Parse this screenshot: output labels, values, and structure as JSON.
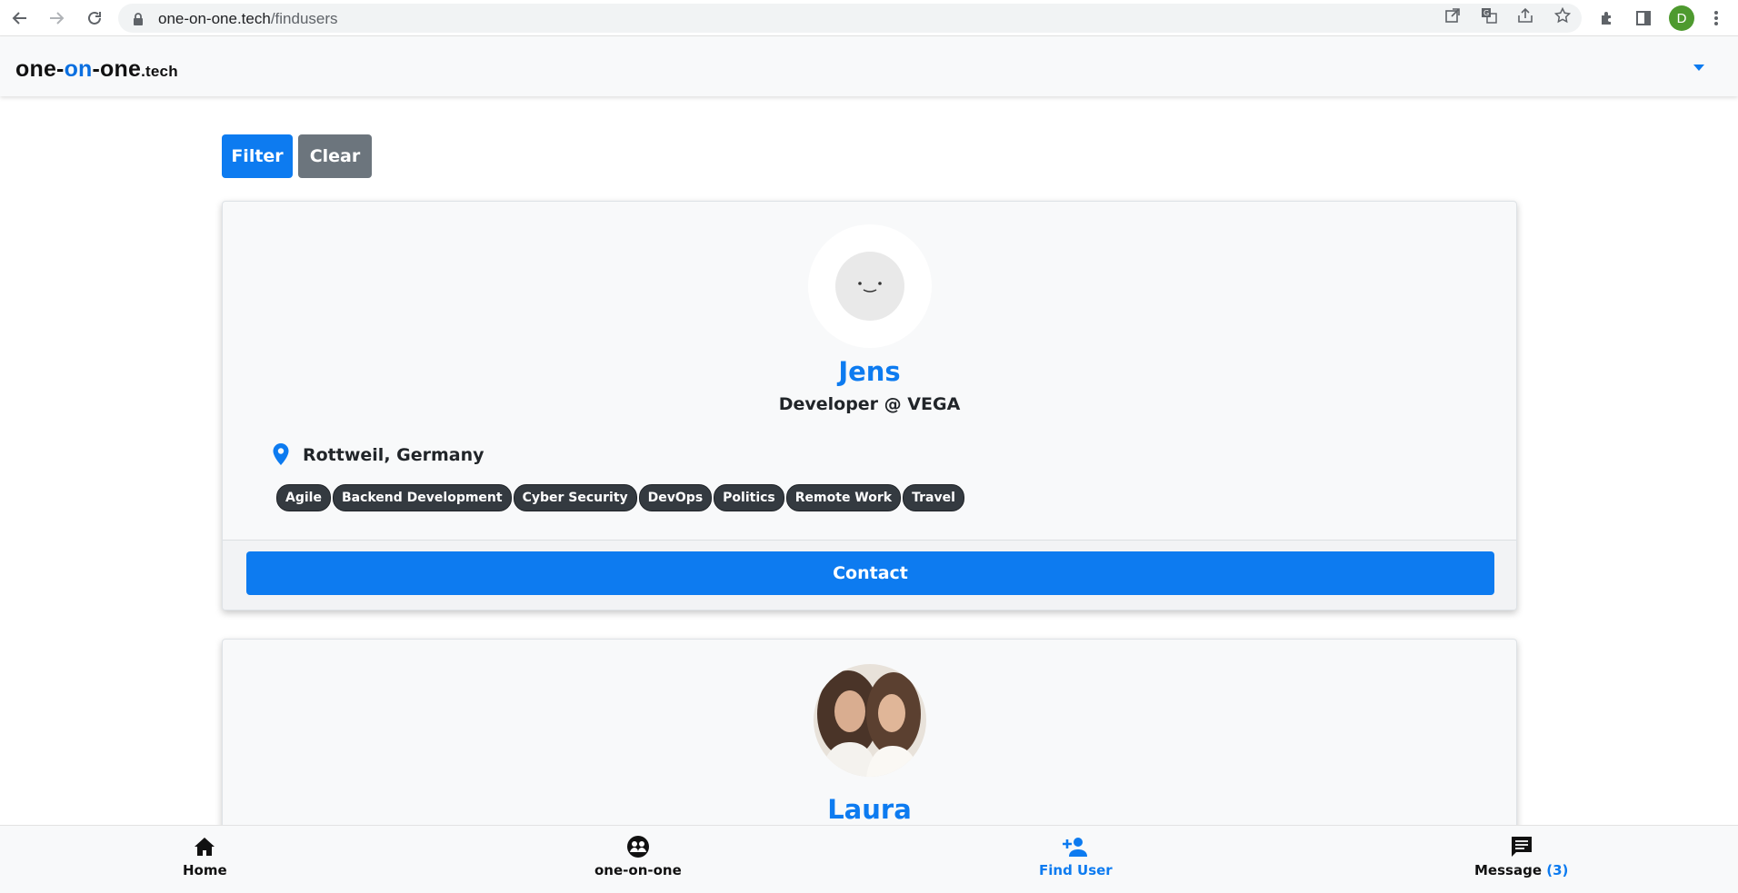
{
  "browser": {
    "url_host": "one-on-one.tech",
    "url_path": "/findusers",
    "profile_initial": "D"
  },
  "app": {
    "brand_part1": "one-",
    "brand_part2": "on",
    "brand_part3": "-one",
    "brand_tld": ".tech",
    "accent_color": "#0d7bf0"
  },
  "toolbar": {
    "filter_label": "Filter",
    "clear_label": "Clear"
  },
  "users": [
    {
      "name": "Jens",
      "title": "Developer @ VEGA",
      "location": "Rottweil, Germany",
      "tags": [
        "Agile",
        "Backend Development",
        "Cyber Security",
        "DevOps",
        "Politics",
        "Remote Work",
        "Travel"
      ],
      "contact_label": "Contact"
    },
    {
      "name": "Laura"
    }
  ],
  "bottom_nav": {
    "home": "Home",
    "one_on_one": "one-on-one",
    "find_user": "Find User",
    "message": "Message",
    "message_count": "(3)"
  }
}
